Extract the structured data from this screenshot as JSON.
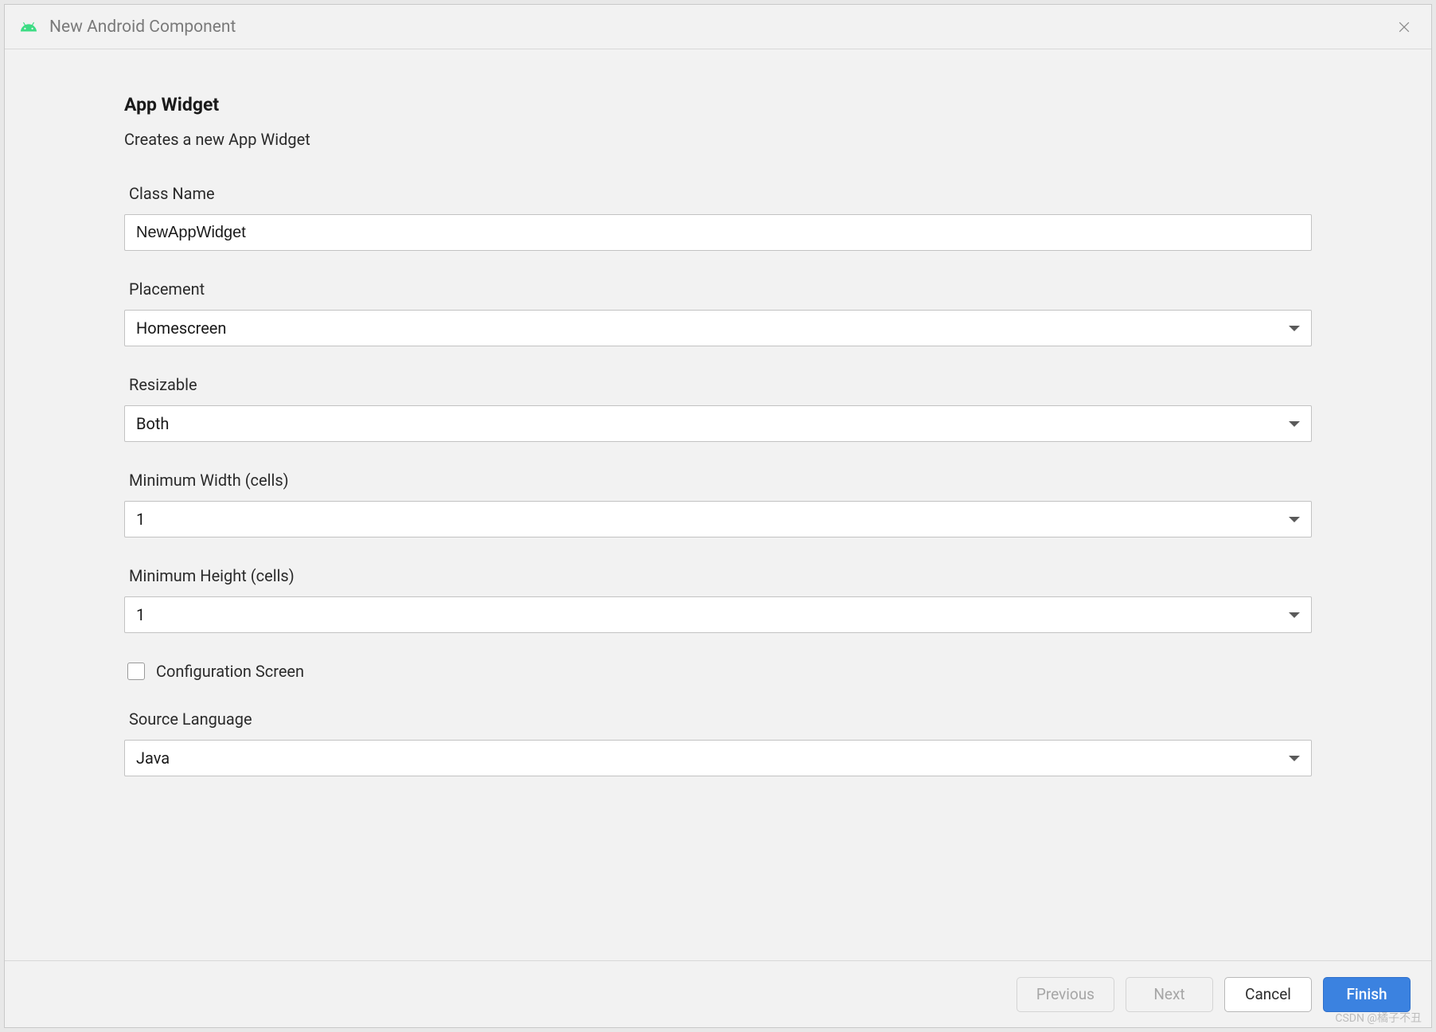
{
  "titlebar": {
    "title": "New Android Component"
  },
  "header": {
    "heading": "App Widget",
    "subheading": "Creates a new App Widget"
  },
  "form": {
    "className": {
      "label": "Class Name",
      "value": "NewAppWidget"
    },
    "placement": {
      "label": "Placement",
      "value": "Homescreen"
    },
    "resizable": {
      "label": "Resizable",
      "value": "Both"
    },
    "minWidth": {
      "label": "Minimum Width (cells)",
      "value": "1"
    },
    "minHeight": {
      "label": "Minimum Height (cells)",
      "value": "1"
    },
    "configScreen": {
      "label": "Configuration Screen",
      "checked": false
    },
    "sourceLanguage": {
      "label": "Source Language",
      "value": "Java"
    }
  },
  "footer": {
    "previous": "Previous",
    "next": "Next",
    "cancel": "Cancel",
    "finish": "Finish"
  },
  "watermark": "CSDN @橘子不丑"
}
